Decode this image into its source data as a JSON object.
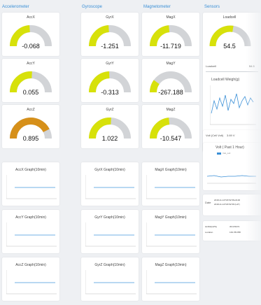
{
  "columns": {
    "accelerometer": "Accelerometer",
    "gyroscope": "Gyroscope",
    "magnetometer": "Magnetometer",
    "sensors": "Sensors"
  },
  "gauges": [
    {
      "id": "accx",
      "title": "AccX",
      "value": "-0.068",
      "level": 0.48,
      "color": "#d7e10a"
    },
    {
      "id": "accy",
      "title": "AccY",
      "value": "0.055",
      "level": 0.52,
      "color": "#d7e10a"
    },
    {
      "id": "accz",
      "title": "AccZ",
      "value": "0.895",
      "level": 0.85,
      "color": "#d6901a"
    },
    {
      "id": "gyrx",
      "title": "GyrX",
      "value": "-1.251",
      "level": 0.48,
      "color": "#d7e10a"
    },
    {
      "id": "gyry",
      "title": "GyrY",
      "value": "-0.313",
      "level": 0.49,
      "color": "#d7e10a"
    },
    {
      "id": "gyrz",
      "title": "GyrZ",
      "value": "1.022",
      "level": 0.52,
      "color": "#d7e10a"
    },
    {
      "id": "magx",
      "title": "MagX",
      "value": "-11.719",
      "level": 0.47,
      "color": "#d7e10a"
    },
    {
      "id": "magy",
      "title": "MagY",
      "value": "-267.188",
      "level": 0.2,
      "color": "#d7e10a"
    },
    {
      "id": "magz",
      "title": "MagZ",
      "value": "-10.547",
      "level": 0.47,
      "color": "#d7e10a"
    },
    {
      "id": "loadcell",
      "title": "Loadcell",
      "value": "54.5",
      "level": 0.55,
      "color": "#d7e10a"
    }
  ],
  "graphs": [
    {
      "id": "accx-graph",
      "title": "AccX Graph(10min)"
    },
    {
      "id": "accy-graph",
      "title": "AccY Graph(10min)"
    },
    {
      "id": "accz-graph",
      "title": "AccZ Graph(10min)"
    },
    {
      "id": "gyrx-graph",
      "title": "GyrX Graph(10min)"
    },
    {
      "id": "gyry-graph",
      "title": "GyrY Graph(10min)"
    },
    {
      "id": "gyrz-graph",
      "title": "GyrZ Graph(10min)"
    },
    {
      "id": "magx-graph",
      "title": "MagX Graph(10min)"
    },
    {
      "id": "magy-graph",
      "title": "MagY Graph(10min)"
    },
    {
      "id": "magz-graph",
      "title": "MagZ Graph(10min)"
    }
  ],
  "sensors": {
    "loadcell_label": "Loadcell",
    "loadcell_value": "54.5",
    "weigh_title": "Loadcell Weigh(g)",
    "volt_label": "Volt (Cell Volt)",
    "volt_value": "3.69 V",
    "volt_graph_title": "Volt ( Past 1 Hour)",
    "volt_legend": "Volt_cell",
    "date_label": "Date",
    "date_value_1": "2018-11-12T18:52:58+0100",
    "date_value_2": "2018-11-12T18:52:58 (LAT)",
    "gps_label": "GNSS(GPS)",
    "gps_lat": "35.676073",
    "location_label": "Location",
    "gps_lng": "139.781788"
  }
}
